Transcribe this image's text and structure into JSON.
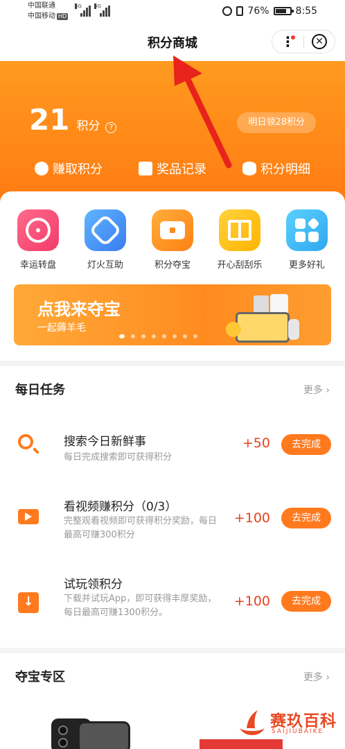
{
  "status_bar": {
    "carrier_1": "中国联通",
    "carrier_2": "中国移动",
    "hd": "HD",
    "signal_1": "4G",
    "signal_2": "4G",
    "battery": "76%",
    "time": "8:55"
  },
  "nav": {
    "title": "积分商城",
    "more_glyph": "⋮",
    "close_glyph": "✕"
  },
  "header": {
    "points": "21",
    "points_unit": "积分",
    "help_glyph": "?",
    "tomorrow_badge": "明日领28积分",
    "links": [
      {
        "label": "赚取积分",
        "icon": "piggy-bank-icon"
      },
      {
        "label": "奖品记录",
        "icon": "clipboard-icon"
      },
      {
        "label": "积分明细",
        "icon": "coins-icon"
      }
    ]
  },
  "features": [
    {
      "label": "幸运转盘",
      "icon": "lucky-wheel-icon"
    },
    {
      "label": "灯火互助",
      "icon": "light-help-icon"
    },
    {
      "label": "积分夺宝",
      "icon": "treasure-chest-icon"
    },
    {
      "label": "开心刮刮乐",
      "icon": "gift-box-icon"
    },
    {
      "label": "更多好礼",
      "icon": "more-apps-icon"
    }
  ],
  "banner": {
    "title": "点我来夺宝",
    "subtitle": "一起薅羊毛",
    "page_count": 8,
    "active_page": 0
  },
  "daily_tasks": {
    "title": "每日任务",
    "more": "更多 ›",
    "items": [
      {
        "title": "搜索今日新鲜事",
        "desc": "每日完成搜索即可获得积分",
        "points": "+50",
        "button": "去完成",
        "icon": "search-icon"
      },
      {
        "title": "看视频赚积分（0/3）",
        "desc": "完整观看视频即可获得积分奖励，每日最高可赚300积分",
        "points": "+100",
        "button": "去完成",
        "icon": "video-icon"
      },
      {
        "title": "试玩领积分",
        "desc": "下载并试玩App，即可获得丰厚奖励，每日最高可赚1300积分。",
        "points": "+100",
        "button": "去完成",
        "icon": "download-icon"
      }
    ]
  },
  "treasure_zone": {
    "title": "夺宝专区",
    "more": "更多 ›"
  },
  "watermark": {
    "cn": "赛玖百科",
    "en": "SAIJIUBAIKE"
  },
  "colors": {
    "accent": "#ff7a1e",
    "header_top": "#ff9a1f",
    "points_red": "#e8411e",
    "annotation_arrow": "#e8231b"
  }
}
